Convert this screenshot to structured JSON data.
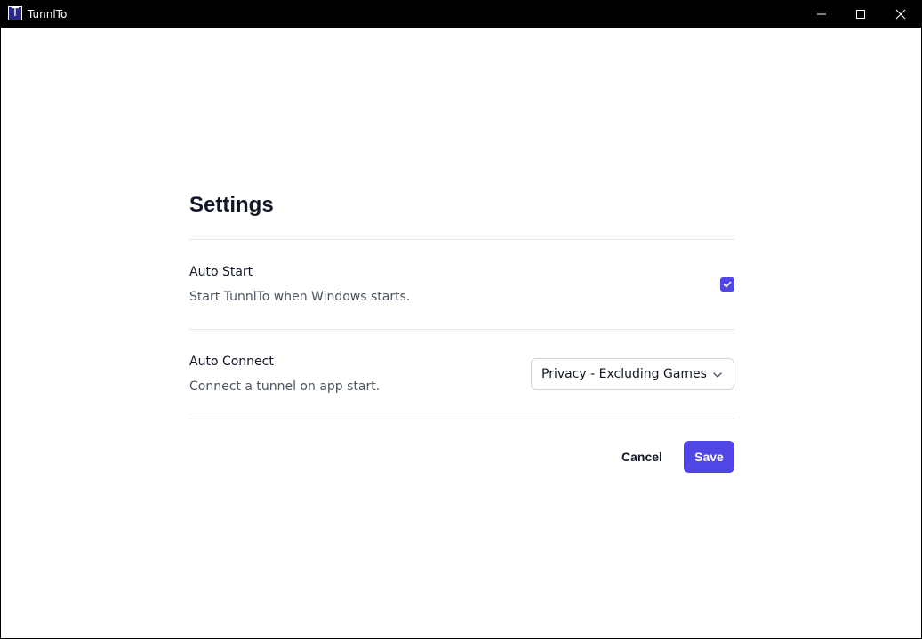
{
  "window": {
    "app_icon_letter": "T",
    "title": "TunnlTo"
  },
  "settings": {
    "title": "Settings",
    "auto_start": {
      "label": "Auto Start",
      "description": "Start TunnlTo when Windows starts.",
      "checked": true
    },
    "auto_connect": {
      "label": "Auto Connect",
      "description": "Connect a tunnel on app start.",
      "selected": "Privacy - Excluding Games"
    },
    "actions": {
      "cancel_label": "Cancel",
      "save_label": "Save"
    }
  },
  "colors": {
    "accent": "#4f46e5",
    "titlebar": "#000000",
    "divider": "#e5e7eb",
    "text_primary": "#111827",
    "text_secondary": "#4b5563"
  },
  "icons": {
    "app": "tunnlto-logo-icon",
    "minimize": "minimize-icon",
    "maximize": "maximize-icon",
    "close": "close-icon",
    "check": "check-icon",
    "chevron": "chevron-down-icon"
  }
}
